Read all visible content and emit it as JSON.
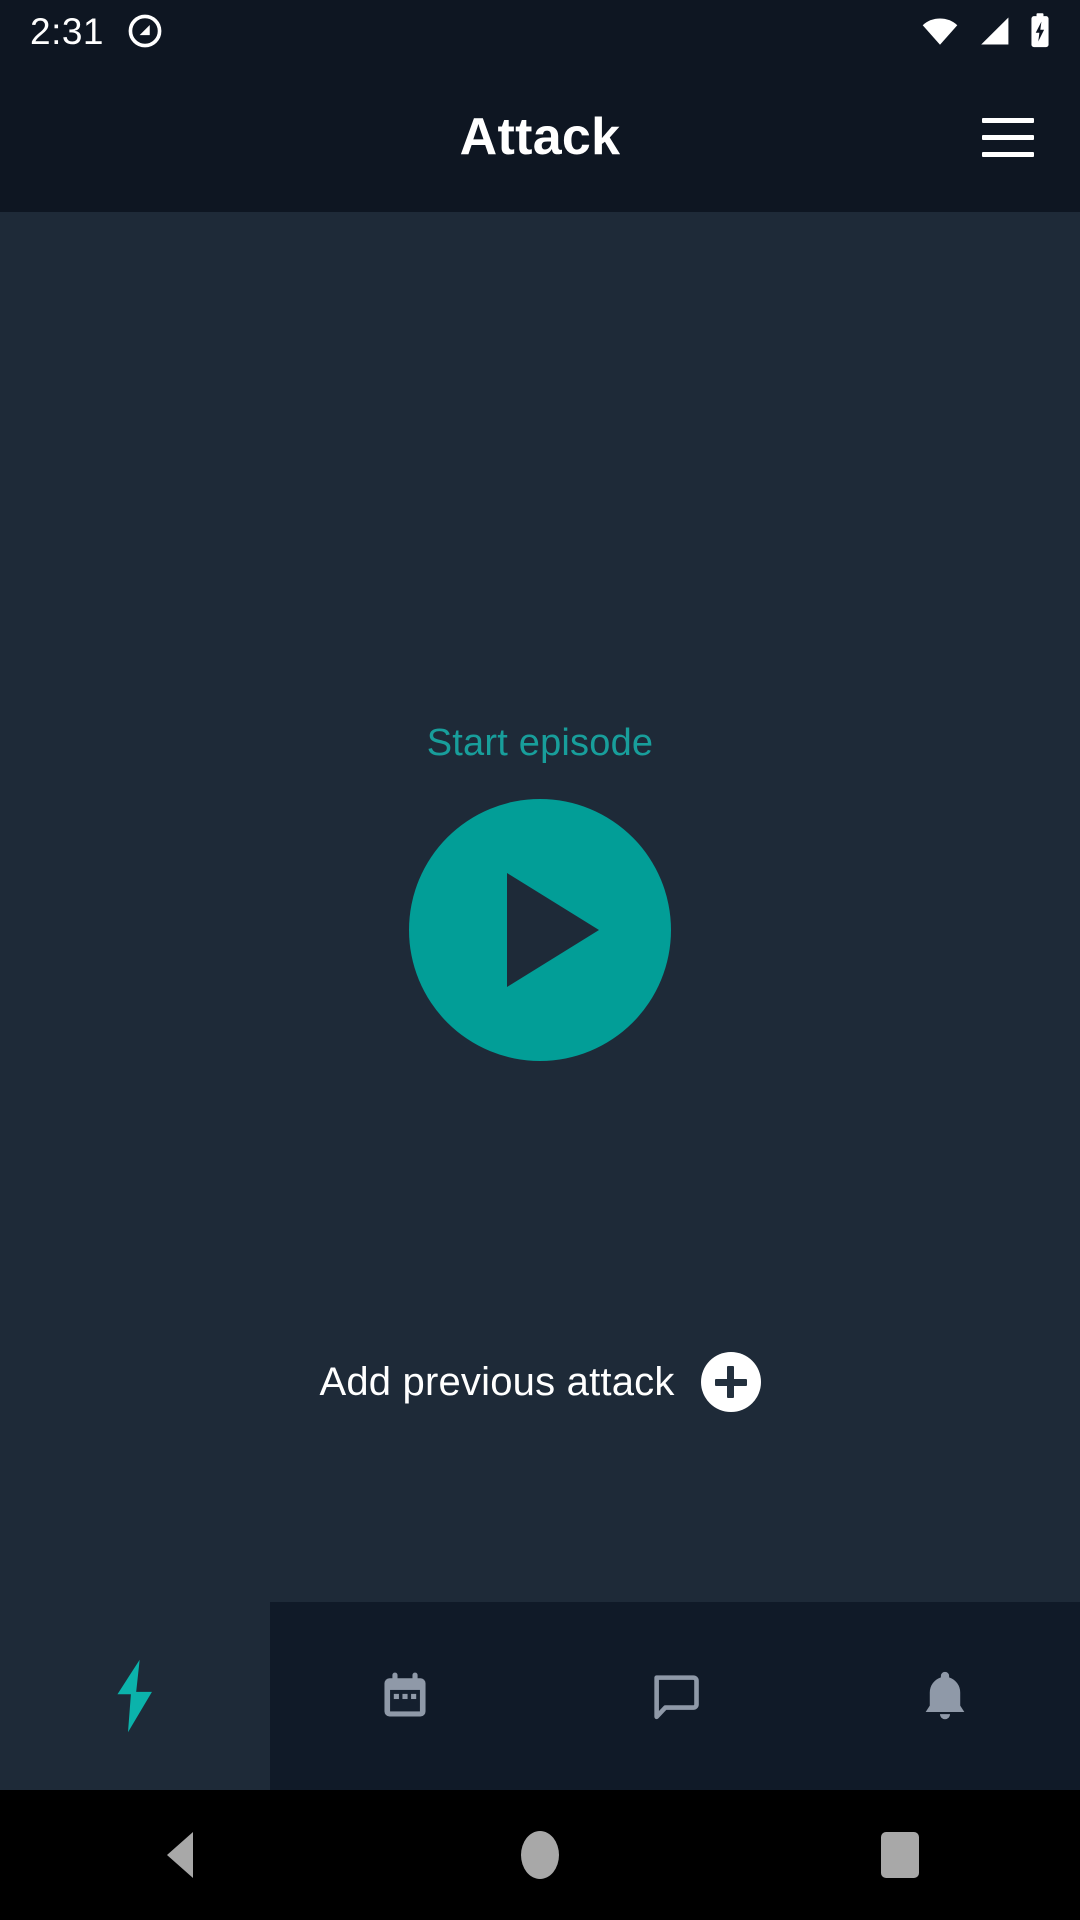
{
  "status_bar": {
    "time": "2:31",
    "left_icon": "android-q-icon",
    "icons": [
      "wifi-icon",
      "cellular-signal-icon",
      "battery-charging-icon"
    ],
    "background": "#0e1622",
    "foreground": "#ffffff"
  },
  "app_bar": {
    "title": "Attack",
    "menu_icon": "hamburger-menu-icon",
    "background": "#0e1622"
  },
  "main": {
    "start_label": "Start episode",
    "start_label_color": "#189e9b",
    "play_icon": "play-icon",
    "play_button_color": "#029e97",
    "add_previous_label": "Add previous attack",
    "add_icon": "plus-circle-icon",
    "background": "#1e2a38"
  },
  "tab_bar": {
    "background": "#101a28",
    "active_background": "#1e2a38",
    "active_color": "#0bb3ab",
    "inactive_color": "#8f99a8",
    "items": [
      {
        "name": "attack",
        "icon": "lightning-bolt-icon",
        "active": true
      },
      {
        "name": "calendar",
        "icon": "calendar-icon",
        "active": false
      },
      {
        "name": "messages",
        "icon": "chat-bubble-icon",
        "active": false
      },
      {
        "name": "notifications",
        "icon": "bell-icon",
        "active": false
      }
    ]
  },
  "nav_bar": {
    "background": "#000000",
    "color": "#a8a8a8",
    "buttons": [
      {
        "name": "back",
        "icon": "triangle-back-icon"
      },
      {
        "name": "home",
        "icon": "circle-home-icon"
      },
      {
        "name": "recents",
        "icon": "square-recents-icon"
      }
    ]
  }
}
